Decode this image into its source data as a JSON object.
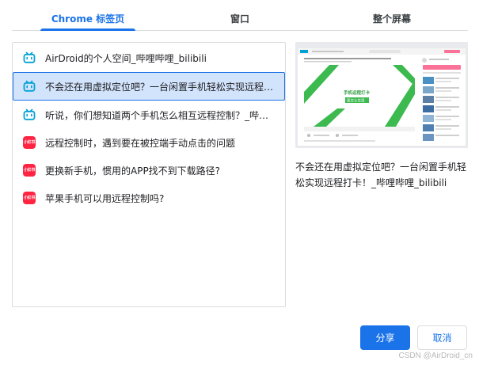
{
  "tabs": [
    {
      "label": "Chrome 标签页",
      "active": true
    },
    {
      "label": "窗口",
      "active": false
    },
    {
      "label": "整个屏幕",
      "active": false
    }
  ],
  "items": [
    {
      "icon": "bilibili-icon",
      "label": "AirDroid的个人空间_哔哩哔哩_bilibili",
      "selected": false
    },
    {
      "icon": "bilibili-icon",
      "label": "不会还在用虚拟定位吧？一台闲置手机轻松实现远程打卡！_哔哩哔哩_bilibili",
      "selected": true
    },
    {
      "icon": "bilibili-icon",
      "label": "听说，你们想知道两个手机怎么相互远程控制？_哔哩哔哩_bilibili",
      "selected": false
    },
    {
      "icon": "xiaohongshu-icon",
      "label": "远程控制时，遇到要在被控端手动点击的问题",
      "selected": false
    },
    {
      "icon": "xiaohongshu-icon",
      "label": "更换新手机，惯用的APP找不到下载路径?",
      "selected": false
    },
    {
      "icon": "xiaohongshu-icon",
      "label": "苹果手机可以用远程控制吗?",
      "selected": false
    }
  ],
  "xhs_icon_text": "小红书",
  "preview": {
    "caption": "不会还在用虚拟定位吧？一台闲置手机轻松实现远程打卡！_哔哩哔哩_bilibili",
    "video_title": "手机远程打卡",
    "video_subtitle": "要怎么实现"
  },
  "buttons": {
    "share": "分享",
    "cancel": "取消"
  },
  "watermark": "CSDN @AirDroid_cn",
  "colors": {
    "accent": "#1a73e8",
    "selected_bg": "#d2e3fc",
    "bilibili": "#00a1d6",
    "xiaohongshu": "#ff2442"
  }
}
